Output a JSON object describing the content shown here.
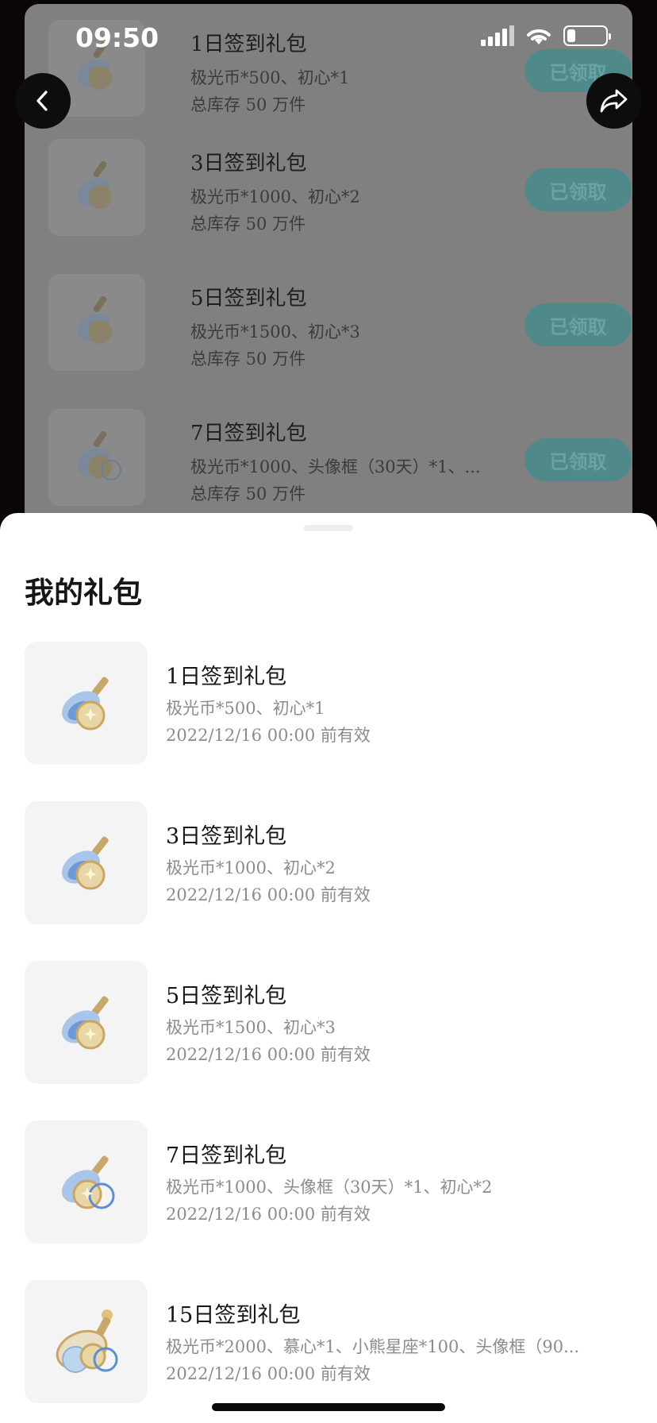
{
  "status_bar": {
    "time": "09:50"
  },
  "background_list": {
    "items": [
      {
        "title": "1日签到礼包",
        "desc": "极光币*500、初心*1",
        "stock": "总库存 50 万件",
        "button": "已领取"
      },
      {
        "title": "3日签到礼包",
        "desc": "极光币*1000、初心*2",
        "stock": "总库存 50 万件",
        "button": "已领取"
      },
      {
        "title": "5日签到礼包",
        "desc": "极光币*1500、初心*3",
        "stock": "总库存 50 万件",
        "button": "已领取"
      },
      {
        "title": "7日签到礼包",
        "desc": "极光币*1000、头像框（30天）*1、...",
        "stock": "总库存 50 万件",
        "button": "已领取"
      }
    ]
  },
  "sheet": {
    "title": "我的礼包",
    "items": [
      {
        "name": "1日签到礼包",
        "desc": "极光币*500、初心*1",
        "expiry": "2022/12/16 00:00 前有效"
      },
      {
        "name": "3日签到礼包",
        "desc": "极光币*1000、初心*2",
        "expiry": "2022/12/16 00:00 前有效"
      },
      {
        "name": "5日签到礼包",
        "desc": "极光币*1500、初心*3",
        "expiry": "2022/12/16 00:00 前有效"
      },
      {
        "name": "7日签到礼包",
        "desc": "极光币*1000、头像框（30天）*1、初心*2",
        "expiry": "2022/12/16 00:00 前有效"
      },
      {
        "name": "15日签到礼包",
        "desc": "极光币*2000、慕心*1、小熊星座*100、头像框（90...",
        "expiry": "2022/12/16 00:00 前有效"
      }
    ]
  },
  "icons": {
    "back": "chevron-left-icon",
    "share": "share-arrow-icon",
    "gift": "potion-bottle-coin-icon"
  },
  "colors": {
    "claimed_button": "#4f8989",
    "sheet_bg": "#ffffff",
    "muted_text": "#8c8c8c"
  }
}
